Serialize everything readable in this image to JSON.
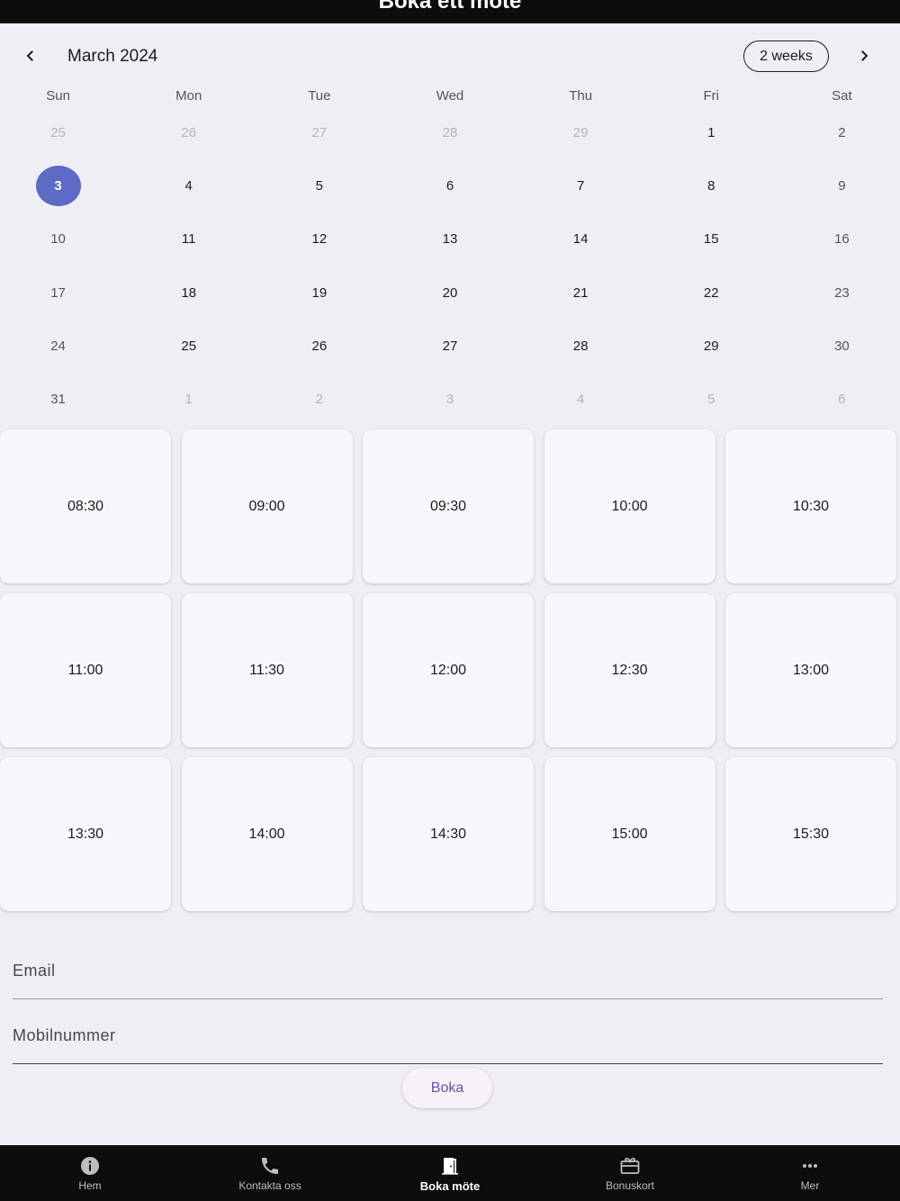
{
  "app_bar": {
    "title": "Boka ett möte"
  },
  "calendar": {
    "month_title": "March 2024",
    "format_button": "2 weeks",
    "weekdays": [
      "Sun",
      "Mon",
      "Tue",
      "Wed",
      "Thu",
      "Fri",
      "Sat"
    ],
    "weeks": [
      [
        {
          "d": "25",
          "o": true
        },
        {
          "d": "26",
          "o": true
        },
        {
          "d": "27",
          "o": true
        },
        {
          "d": "28",
          "o": true
        },
        {
          "d": "29",
          "o": true
        },
        {
          "d": "1"
        },
        {
          "d": "2",
          "w": true
        }
      ],
      [
        {
          "d": "3",
          "s": true
        },
        {
          "d": "4"
        },
        {
          "d": "5"
        },
        {
          "d": "6"
        },
        {
          "d": "7"
        },
        {
          "d": "8"
        },
        {
          "d": "9",
          "w": true
        }
      ],
      [
        {
          "d": "10",
          "w": true
        },
        {
          "d": "11"
        },
        {
          "d": "12"
        },
        {
          "d": "13"
        },
        {
          "d": "14"
        },
        {
          "d": "15"
        },
        {
          "d": "16",
          "w": true
        }
      ],
      [
        {
          "d": "17",
          "w": true
        },
        {
          "d": "18"
        },
        {
          "d": "19"
        },
        {
          "d": "20"
        },
        {
          "d": "21"
        },
        {
          "d": "22"
        },
        {
          "d": "23",
          "w": true
        }
      ],
      [
        {
          "d": "24",
          "w": true
        },
        {
          "d": "25"
        },
        {
          "d": "26"
        },
        {
          "d": "27"
        },
        {
          "d": "28"
        },
        {
          "d": "29"
        },
        {
          "d": "30",
          "w": true
        }
      ],
      [
        {
          "d": "31",
          "w": true
        },
        {
          "d": "1",
          "o": true
        },
        {
          "d": "2",
          "o": true
        },
        {
          "d": "3",
          "o": true
        },
        {
          "d": "4",
          "o": true
        },
        {
          "d": "5",
          "o": true
        },
        {
          "d": "6",
          "o": true
        }
      ]
    ],
    "selected_color": "#5e6bc4"
  },
  "time_slots": [
    "08:30",
    "09:00",
    "09:30",
    "10:00",
    "10:30",
    "11:00",
    "11:30",
    "12:00",
    "12:30",
    "13:00",
    "13:30",
    "14:00",
    "14:30",
    "15:00",
    "15:30"
  ],
  "form": {
    "email_placeholder": "Email",
    "phone_placeholder": "Mobilnummer",
    "submit_label": "Boka"
  },
  "bottom_nav": {
    "items": [
      {
        "label": "Hem",
        "icon": "info-icon"
      },
      {
        "label": "Kontakta oss",
        "icon": "phone-icon"
      },
      {
        "label": "Boka möte",
        "icon": "door-icon",
        "active": true
      },
      {
        "label": "Bonuskort",
        "icon": "card-giftcard-icon"
      },
      {
        "label": "Mer",
        "icon": "more-horiz-icon"
      }
    ]
  }
}
